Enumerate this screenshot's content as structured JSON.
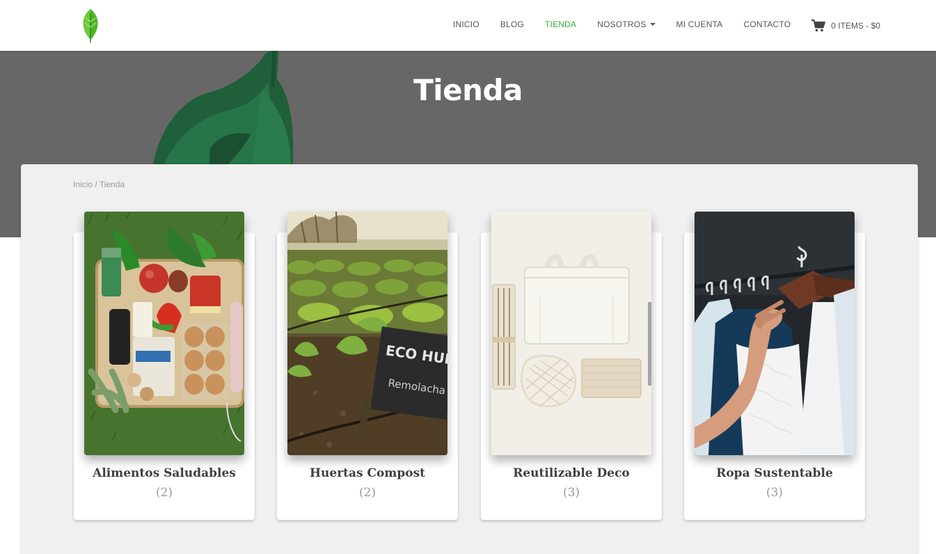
{
  "nav": {
    "items": [
      "Inicio",
      "Blog",
      "Tienda",
      "Nosotros",
      "Mi cuenta",
      "Contacto"
    ],
    "active": "Tienda",
    "cart": "0 ITEMS - $0"
  },
  "hero": {
    "title": "Tienda"
  },
  "breadcrumb": {
    "home": "Inicio",
    "separator": " / ",
    "current": "Tienda"
  },
  "categories": [
    {
      "name": "Alimentos Saludables",
      "count": "(2)"
    },
    {
      "name": "Huertas Compost",
      "count": "(2)"
    },
    {
      "name": "Reutilizable Deco",
      "count": "(3)"
    },
    {
      "name": "Ropa Sustentable",
      "count": "(3)"
    }
  ],
  "colors": {
    "accent": "#2bb238",
    "text": "#3c4043",
    "muted": "#999999",
    "hero": "#6b6b6b"
  }
}
